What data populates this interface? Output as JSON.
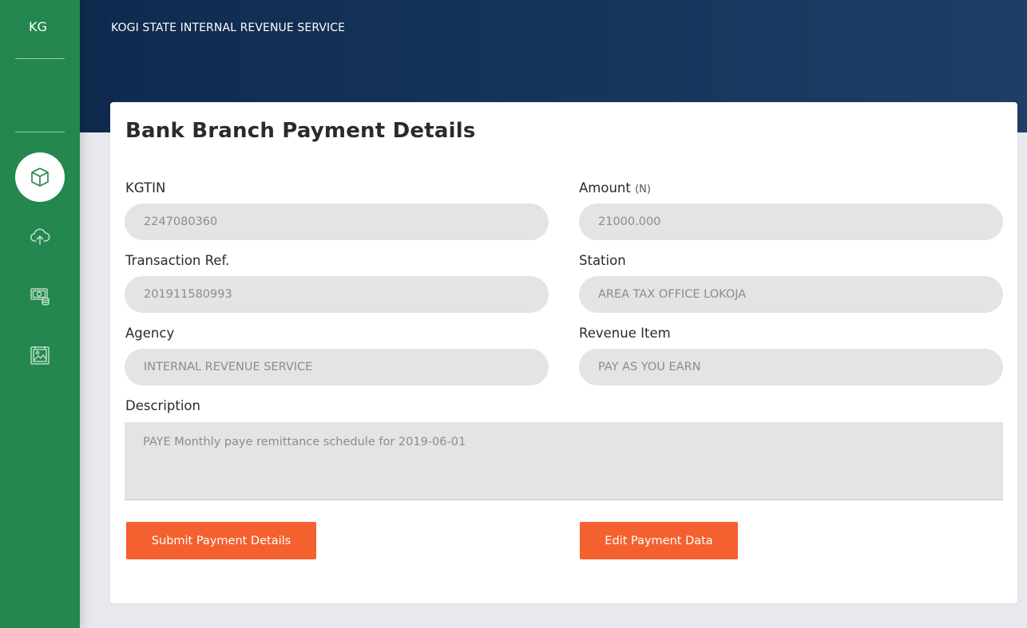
{
  "sidebar": {
    "brand": "KG",
    "items": [
      {
        "icon": "cube-icon",
        "active": true
      },
      {
        "icon": "cloud-upload-icon",
        "active": false
      },
      {
        "icon": "money-coins-icon",
        "active": false
      },
      {
        "icon": "image-gallery-icon",
        "active": false
      }
    ]
  },
  "header": {
    "title": "KOGI STATE INTERNAL REVENUE SERVICE"
  },
  "card": {
    "title": "Bank Branch Payment Details"
  },
  "form": {
    "kgtin": {
      "label": "KGTIN",
      "value": "2247080360"
    },
    "amount": {
      "label": "Amount",
      "unit": "(N)",
      "value": "21000.000"
    },
    "transaction_ref": {
      "label": "Transaction Ref.",
      "value": "201911580993"
    },
    "station": {
      "label": "Station",
      "value": "AREA TAX OFFICE LOKOJA"
    },
    "agency": {
      "label": "Agency",
      "value": "INTERNAL REVENUE SERVICE"
    },
    "revenue_item": {
      "label": "Revenue Item",
      "value": "PAY AS YOU EARN"
    },
    "description": {
      "label": "Description",
      "value": "PAYE Monthly paye remittance schedule for 2019-06-01"
    }
  },
  "buttons": {
    "submit_label": "Submit Payment Details",
    "edit_label": "Edit Payment Data"
  },
  "colors": {
    "sidebar": "#23874f",
    "header": "#163459",
    "accent_button": "#f4612f",
    "field_bg": "#e4e4e4"
  }
}
